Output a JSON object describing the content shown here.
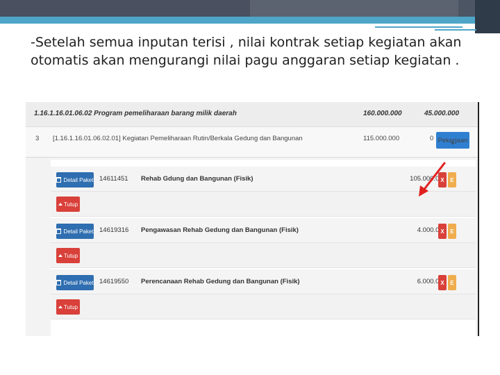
{
  "slide": {
    "text": "-Setelah semua inputan terisi , nilai kontrak setiap kegiatan akan otomatis akan mengurangi nilai pagu anggaran setiap kegiatan ."
  },
  "program": {
    "title": "1.16.1.16.01.06.02 Program pemeliharaan barang milik daerah",
    "pagu": "160.000.000",
    "sisa": "45.000.000"
  },
  "kegiatan": {
    "no": "3",
    "title": "[1.16.1.16.01.06.02.01] Kegiatan Pemeliharaan Rutin/Berkala Gedung dan Bangunan",
    "pagu": "115.000.000",
    "sisa": "0",
    "pekerjaan_label": "Pekerjaan",
    "pekerjaan_icon": "plus-icon"
  },
  "buttons": {
    "detail_label": "Detail Paket",
    "tutup_label": "Tutup",
    "delete_label": "X",
    "edit_label": "E"
  },
  "pakets": [
    {
      "code": "14611451",
      "name": "Rehab Gdung dan Bangunan (Fisik)",
      "amount": "105.000.000"
    },
    {
      "code": "14619316",
      "name": "Pengawasan Rehab Gedung dan Bangunan (Fisik)",
      "amount": "4.000.000"
    },
    {
      "code": "14619550",
      "name": "Perencanaan Rehab Gedung dan Bangunan (Fisik)",
      "amount": "6.000.000"
    }
  ],
  "colors": {
    "primary_blue": "#2f6eb0",
    "danger_red": "#d9403a",
    "warning_orange": "#f0ad4e",
    "arrow_red": "#e02020",
    "band_blue": "#4ea5c8"
  }
}
